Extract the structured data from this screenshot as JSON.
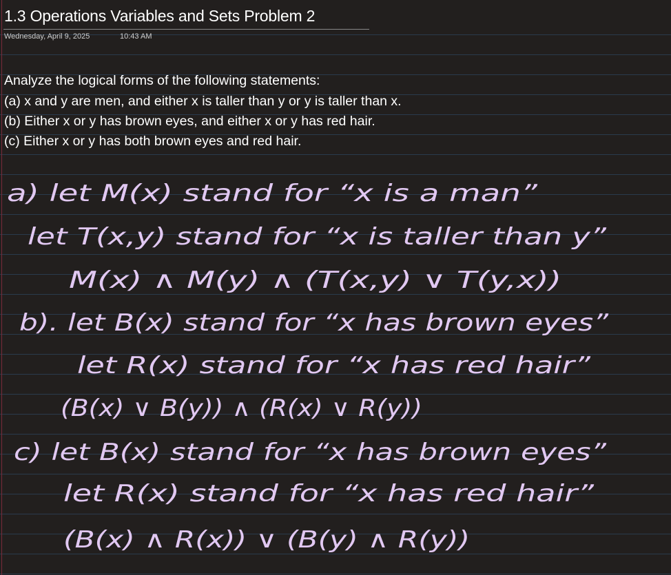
{
  "page": {
    "title": "1.3 Operations Variables and Sets Problem 2",
    "date": "Wednesday, April 9, 2025",
    "time": "10:43 AM"
  },
  "problem": {
    "intro": "Analyze the logical forms of the following statements:",
    "items": [
      "(a) x and y are men, and either x is taller than y or y is taller than x.",
      "(b) Either x or y has brown eyes, and either x or y has red hair.",
      "(c) Either x or y has both brown eyes and red hair."
    ]
  },
  "handwriting": {
    "ink_color": "#e1c8f2",
    "lines": [
      "a) let M(x) stand for “x is a man”",
      "let T(x,y) stand for “x is taller than y”",
      "M(x) ∧ M(y) ∧ (T(x,y) ∨ T(y,x))",
      "b). let B(x) stand for “x has brown eyes”",
      "let R(x) stand for “x has red hair”",
      "(B(x) ∨ B(y)) ∧ (R(x) ∨ R(y))",
      "c) let B(x) stand for “x has brown eyes”",
      "let R(x) stand for “x has red hair”",
      "(B(x) ∧ R(x)) ∨ (B(y) ∧ R(y))"
    ]
  }
}
